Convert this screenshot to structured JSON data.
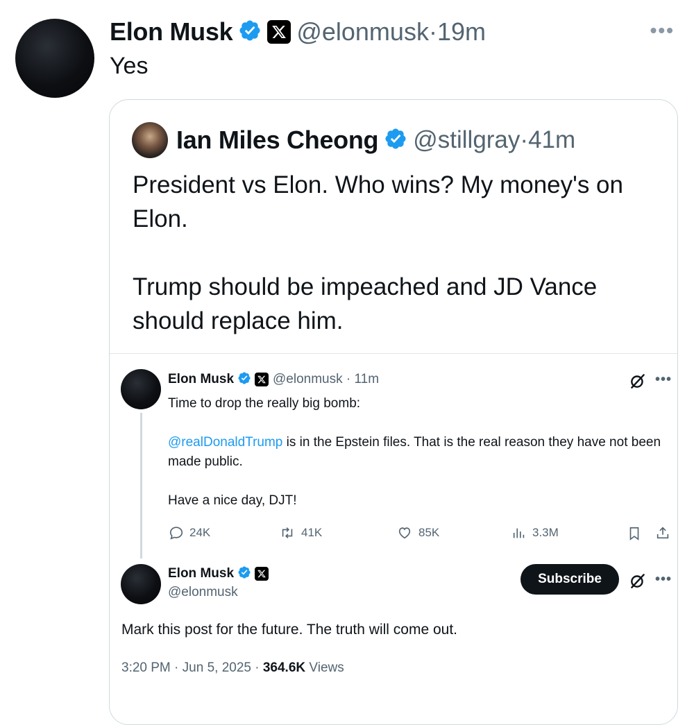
{
  "main_post": {
    "author_name": "Elon Musk",
    "handle": "@elonmusk",
    "separator": "·",
    "time": "19m",
    "text": "Yes",
    "more_label": "•••"
  },
  "quoted_post": {
    "author_name": "Ian Miles Cheong",
    "handle": "@stillgray",
    "separator": "·",
    "time": "41m",
    "text": "President vs Elon. Who wins? My money's on Elon.\n\nTrump should be impeached and JD Vance should replace him."
  },
  "embedded_post_1": {
    "author_name": "Elon Musk",
    "handle": "@elonmusk",
    "separator": "·",
    "time": "11m",
    "line1": "Time to drop the really big bomb:",
    "mention": "@realDonaldTrump",
    "line2_rest": " is in the Epstein files. That is the real reason they have not been made public.",
    "line3": "Have a nice day, DJT!",
    "more_label": "•••",
    "actions": {
      "replies": "24K",
      "reposts": "41K",
      "likes": "85K",
      "views": "3.3M"
    }
  },
  "embedded_post_2": {
    "author_name": "Elon Musk",
    "handle": "@elonmusk",
    "subscribe_label": "Subscribe",
    "more_label": "•••",
    "text": "Mark this post for the future. The truth will come out.",
    "footer_time": "3:20 PM",
    "footer_sep1": " · ",
    "footer_date": "Jun 5, 2025",
    "footer_sep2": " · ",
    "footer_views_count": "364.6K",
    "footer_views_label": " Views"
  },
  "colors": {
    "verified_blue": "#1d9bf0",
    "text_primary": "#0f1419",
    "text_muted": "#536471",
    "border": "#cfd9de"
  },
  "icons": [
    "verified-badge-icon",
    "x-logo-icon",
    "more-icon",
    "grok-icon",
    "reply-icon",
    "repost-icon",
    "like-icon",
    "views-icon",
    "bookmark-icon",
    "share-icon"
  ]
}
